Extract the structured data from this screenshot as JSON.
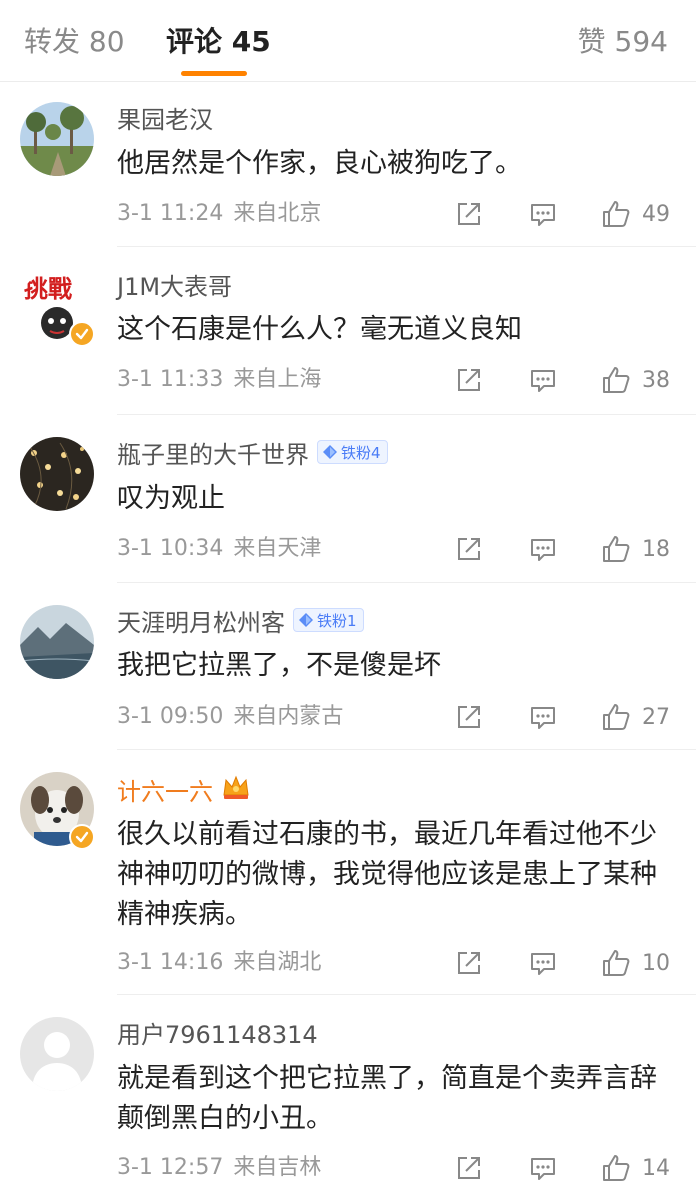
{
  "tabs": {
    "repost_label": "转发 80",
    "comments_label": "评论 45",
    "likes_label": "赞 594"
  },
  "accent_color": "#ff8200",
  "comments": [
    {
      "username": "果园老汉",
      "text": "他居然是个作家，良心被狗吃了。",
      "time": "3-1 11:24",
      "location": "来自北京",
      "likes": "49"
    },
    {
      "username": "J1M大表哥",
      "text": "这个石康是什么人？毫无道义良知",
      "time": "3-1 11:33",
      "location": "来自上海",
      "likes": "38"
    },
    {
      "username": "瓶子里的大千世界",
      "badge": "铁粉4",
      "text": "叹为观止",
      "time": "3-1 10:34",
      "location": "来自天津",
      "likes": "18"
    },
    {
      "username": "天涯明月松州客",
      "badge": "铁粉1",
      "text": "我把它拉黑了，不是傻是坏",
      "time": "3-1 09:50",
      "location": "来自内蒙古",
      "likes": "27"
    },
    {
      "username": "计六一六",
      "text": "很久以前看过石康的书，最近几年看过他不少神神叨叨的微博，我觉得他应该是患上了某种精神疾病。",
      "time": "3-1 14:16",
      "location": "来自湖北",
      "likes": "10"
    },
    {
      "username": "用户7961148314",
      "text": "就是看到这个把它拉黑了，简直是个卖弄言辞颠倒黑白的小丑。",
      "time": "3-1 12:57",
      "location": "来自吉林",
      "likes": "14"
    }
  ],
  "icons": {
    "share": "share-icon",
    "reply": "comment-icon",
    "like": "thumbs-up-icon",
    "verified": "verified-badge-icon",
    "fan": "diamond-icon",
    "crown": "crown-icon"
  }
}
